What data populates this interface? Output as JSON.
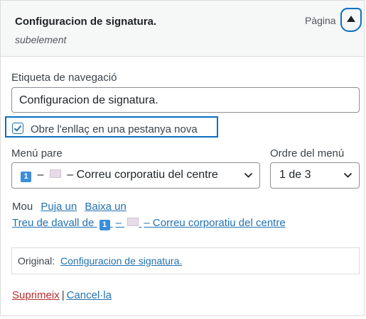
{
  "header": {
    "title": "Configuracion de signatura.",
    "subtitle": "subelement",
    "type": "Pàgina"
  },
  "nav_label": {
    "label": "Etiqueta de navegació",
    "value": "Configuracion de signatura."
  },
  "new_tab": {
    "label": "Obre l'enllaç en una pestanya nova",
    "checked": true
  },
  "parent_menu": {
    "label": "Menú pare",
    "badge": "1",
    "value": "– Correu corporatiu del centre",
    "dash": "–"
  },
  "menu_order": {
    "label": "Ordre del menú",
    "value": "1 de 3"
  },
  "move": {
    "label": "Mou",
    "up": "Puja un",
    "down": "Baixa un",
    "out_prefix": "Treu de davall de",
    "out_badge": "1",
    "out_dash": "–",
    "out_suffix": "– Correu corporatiu del centre"
  },
  "original": {
    "label": "Original:",
    "link": "Configuracion de signatura."
  },
  "actions": {
    "delete": "Suprimeix",
    "separator": "|",
    "cancel": "Cancel·la"
  },
  "colors": {
    "accent": "#2271b1",
    "highlight": "#0a6fc2",
    "delete": "#b32d2e",
    "header_bg": "#f6f7f7"
  },
  "icons": {
    "toggle": "arrow-up-icon",
    "checkbox": "checkmark-icon",
    "select": "chevron-down-icon",
    "badge": "number-one-badge",
    "flag": "flag-icon"
  }
}
